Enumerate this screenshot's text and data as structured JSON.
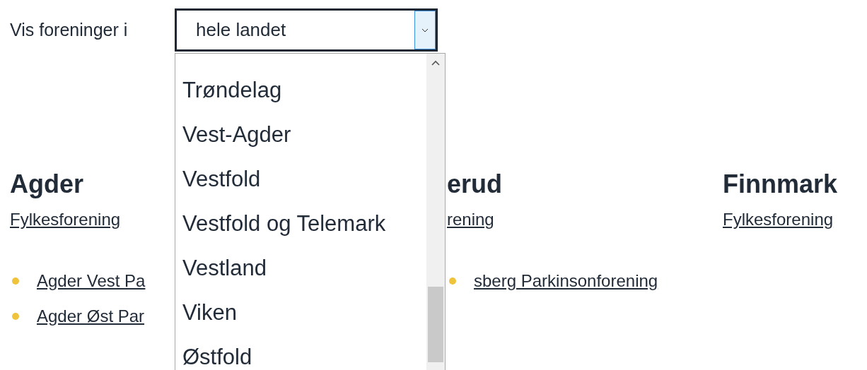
{
  "filter": {
    "label": "Vis foreninger i",
    "select": {
      "value": "hele landet",
      "expanded": true,
      "options": [
        {
          "label": "Trøndelag",
          "selected": false
        },
        {
          "label": "Vest-Agder",
          "selected": false
        },
        {
          "label": "Vestfold",
          "selected": false
        },
        {
          "label": "Vestfold og Telemark",
          "selected": false
        },
        {
          "label": "Vestland",
          "selected": false
        },
        {
          "label": "Viken",
          "selected": false
        },
        {
          "label": "Østfold",
          "selected": false
        }
      ]
    }
  },
  "regions": [
    {
      "heading": "Agder",
      "link": "Fylkesforening",
      "associations": [
        "Agder Vest Pa",
        "Agder Øst Par"
      ]
    },
    {
      "heading": "erud",
      "link": "rening",
      "associations": [
        "sberg Parkinsonforening"
      ]
    },
    {
      "heading": "Finnmark",
      "link": "Fylkesforening"
    }
  ]
}
